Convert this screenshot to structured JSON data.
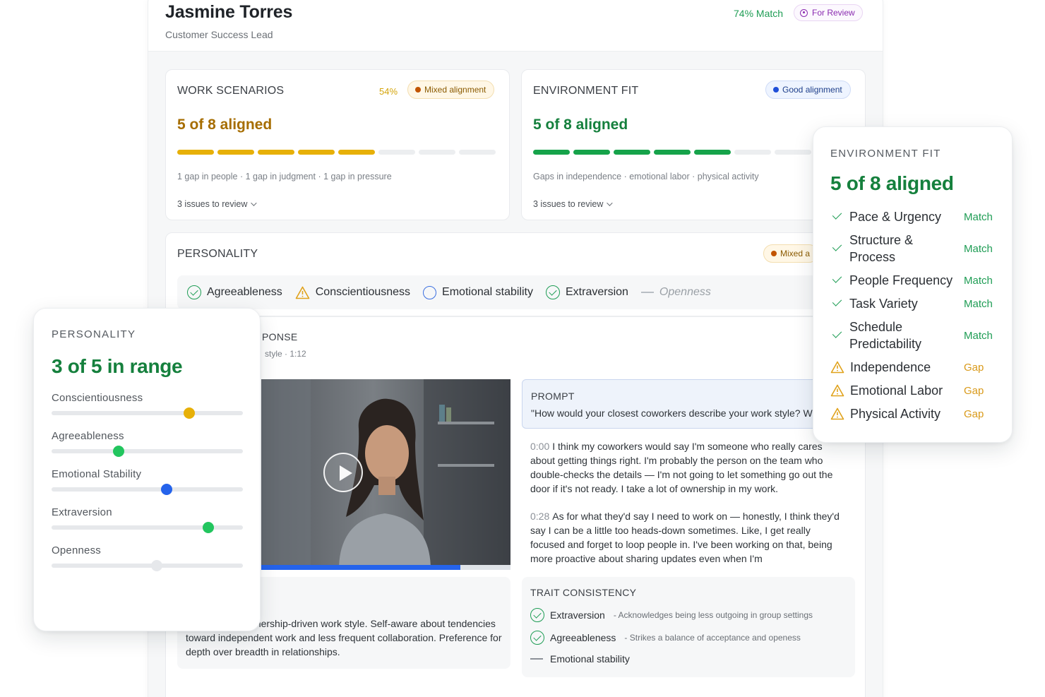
{
  "header": {
    "name": "Jasmine Torres",
    "role": "Customer Success Lead",
    "match": "74% Match",
    "status": "For Review"
  },
  "work_scenarios": {
    "title": "WORK SCENARIOS",
    "pct": "54%",
    "badge": "Mixed alignment",
    "stat": "5 of 8 aligned",
    "segments_filled": 5,
    "segments_total": 8,
    "summary": "1 gap in people · 1 gap in judgment · 1 gap in pressure",
    "issues": "3 issues to review"
  },
  "environment_card": {
    "title": "ENVIRONMENT FIT",
    "badge": "Good alignment",
    "stat": "5 of 8 aligned",
    "segments_filled": 5,
    "segments_total": 8,
    "summary": "Gaps in independence · emotional labor · physical activity",
    "issues": "3 issues to review"
  },
  "personality_card": {
    "title": "PERSONALITY",
    "badge": "Mixed a",
    "traits": [
      {
        "label": "Agreeableness",
        "icon": "check-circle-icon"
      },
      {
        "label": "Conscientiousness",
        "icon": "warning-icon"
      },
      {
        "label": "Emotional stability",
        "icon": "circle-icon"
      },
      {
        "label": "Extraversion",
        "icon": "check-circle-icon"
      },
      {
        "label": "Openness",
        "icon": "dash-icon"
      }
    ],
    "response_heading": "PONSE",
    "response_meta": "style · 1:12",
    "video_progress": 0.8,
    "prompt_label": "PROMPT",
    "prompt_text": "\"How would your closest coworkers describe your work style? W",
    "transcript": [
      {
        "time": "0:00",
        "text": "I think my coworkers would say I'm someone who really cares about getting things right. I'm probably the person on the team who double-checks the details — I'm not going to let something go out the door if it's not ready. I take a lot of ownership in my work."
      },
      {
        "time": "0:28",
        "text": "As for what they'd say I need to work on — honestly, I think they'd say I can be a little too heads-down sometimes. Like, I get really focused and forget to loop people in. I've been working on that, being more proactive about sharing updates even when I'm"
      }
    ],
    "summary_partial": "tail-oriented, ownership-driven work style. Self-aware about tendencies toward independent work and less frequent collaboration. Preference for depth over breadth in relationships.",
    "consistency": {
      "title": "TRAIT CONSISTENCY",
      "items": [
        {
          "trait": "Extraversion",
          "note": "- Acknowledges being less outgoing in group settings",
          "icon": "check-circle-icon"
        },
        {
          "trait": "Agreeableness",
          "note": "- Strikes a balance of acceptance and openess",
          "icon": "check-circle-icon"
        },
        {
          "trait": "Emotional stability",
          "note": "",
          "icon": "dash-icon"
        }
      ]
    }
  },
  "personality_float": {
    "title": "PERSONALITY",
    "stat": "3 of 5 in range",
    "sliders": [
      {
        "label": "Conscientiousness",
        "value": 0.72,
        "color": "#e7b008"
      },
      {
        "label": "Agreeableness",
        "value": 0.35,
        "color": "#22c55e"
      },
      {
        "label": "Emotional Stability",
        "value": 0.6,
        "color": "#2563eb"
      },
      {
        "label": "Extraversion",
        "value": 0.82,
        "color": "#22c55e"
      },
      {
        "label": "Openness",
        "value": 0.55,
        "color": "#e6e8eb"
      }
    ]
  },
  "environment_float": {
    "title": "ENVIRONMENT FIT",
    "stat": "5 of 8 aligned",
    "rows": [
      {
        "label": "Pace & Urgency",
        "status": "Match",
        "kind": "match"
      },
      {
        "label": "Structure & Process",
        "status": "Match",
        "kind": "match"
      },
      {
        "label": "People Frequency",
        "status": "Match",
        "kind": "match"
      },
      {
        "label": "Task Variety",
        "status": "Match",
        "kind": "match"
      },
      {
        "label": "Schedule Predictability",
        "status": "Match",
        "kind": "match"
      },
      {
        "label": "Independence",
        "status": "Gap",
        "kind": "gap"
      },
      {
        "label": "Emotional Labor",
        "status": "Gap",
        "kind": "gap"
      },
      {
        "label": "Physical Activity",
        "status": "Gap",
        "kind": "gap"
      }
    ]
  },
  "colors": {
    "accent_green": "#15803d",
    "accent_gold": "#b07a00",
    "bar_gold": "#e7b008",
    "bar_green": "#16a34a",
    "progress_blue": "#2563eb"
  }
}
